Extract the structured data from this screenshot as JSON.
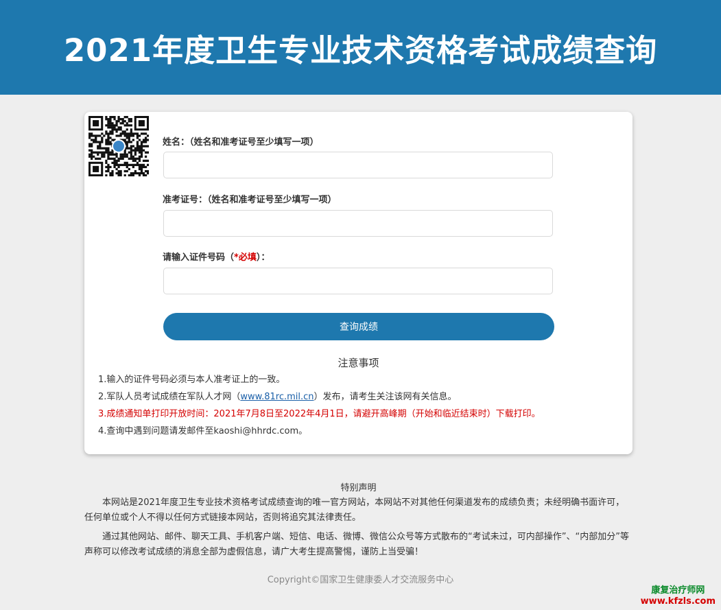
{
  "header": {
    "title": "2021年度卫生专业技术资格考试成绩查询"
  },
  "form": {
    "name_label": "姓名：（姓名和准考证号至少填写一项）",
    "ticket_label": "准考证号：（姓名和准考证号至少填写一项）",
    "id_label_prefix": "请输入证件号码（",
    "id_label_required": "*必填",
    "id_label_suffix": "）：",
    "name_value": "",
    "ticket_value": "",
    "id_value": "",
    "submit_label": "查询成绩"
  },
  "notice": {
    "title": "注意事项",
    "item1": "1.输入的证件号码必须与本人准考证上的一致。",
    "item2_prefix": "2.军队人员考试成绩在军队人才网（",
    "item2_link": "www.81rc.mil.cn",
    "item2_suffix": "）发布，请考生关注该网有关信息。",
    "item3": "3.成绩通知单打印开放时间：2021年7月8日至2022年4月1日，请避开高峰期（开始和临近结束时）下载打印。",
    "item4": "4.查询中遇到问题请发邮件至kaoshi@hhrdc.com。"
  },
  "declaration": {
    "title": "特别声明",
    "para1": "本网站是2021年度卫生专业技术资格考试成绩查询的唯一官方网站，本网站不对其他任何渠道发布的成绩负责；未经明确书面许可，任何单位或个人不得以任何方式链接本网站，否则将追究其法律责任。",
    "para2": "通过其他网站、邮件、聊天工具、手机客户端、短信、电话、微博、微信公众号等方式散布的“考试未过，可内部操作”、“内部加分”等声称可以修改考试成绩的消息全部为虚假信息，请广大考生提高警惕，谨防上当受骗！"
  },
  "footer": {
    "copyright": "Copyright©国家卫生健康委人才交流服务中心"
  },
  "watermark": {
    "line1": "康复治疗师网",
    "line2": "www.kfzls.com"
  },
  "colors": {
    "primary": "#1e78ae",
    "required": "#d40000",
    "background": "#eeeeee"
  },
  "icons": {
    "qr": "qr-code-icon"
  }
}
